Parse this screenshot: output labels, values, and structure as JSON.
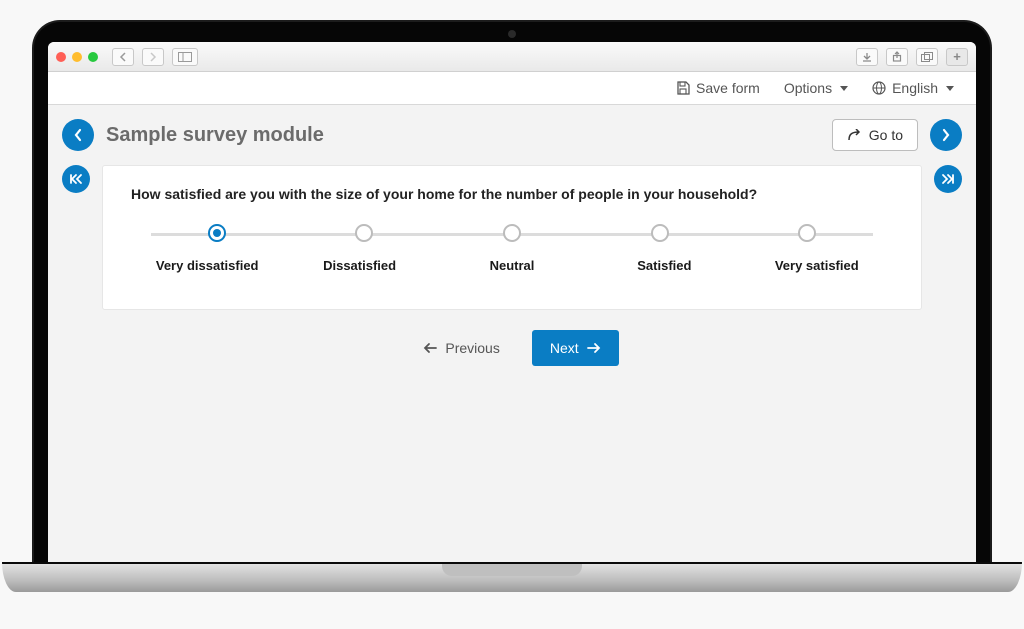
{
  "header": {
    "save_label": "Save form",
    "options_label": "Options",
    "language_label": "English"
  },
  "survey": {
    "title": "Sample survey module",
    "goto_label": "Go to",
    "question": "How satisfied are you with the size of your home for the number of people in your household?",
    "options": [
      {
        "label": "Very dissatisfied",
        "selected": true
      },
      {
        "label": "Dissatisfied",
        "selected": false
      },
      {
        "label": "Neutral",
        "selected": false
      },
      {
        "label": "Satisfied",
        "selected": false
      },
      {
        "label": "Very satisfied",
        "selected": false
      }
    ],
    "prev_label": "Previous",
    "next_label": "Next"
  }
}
